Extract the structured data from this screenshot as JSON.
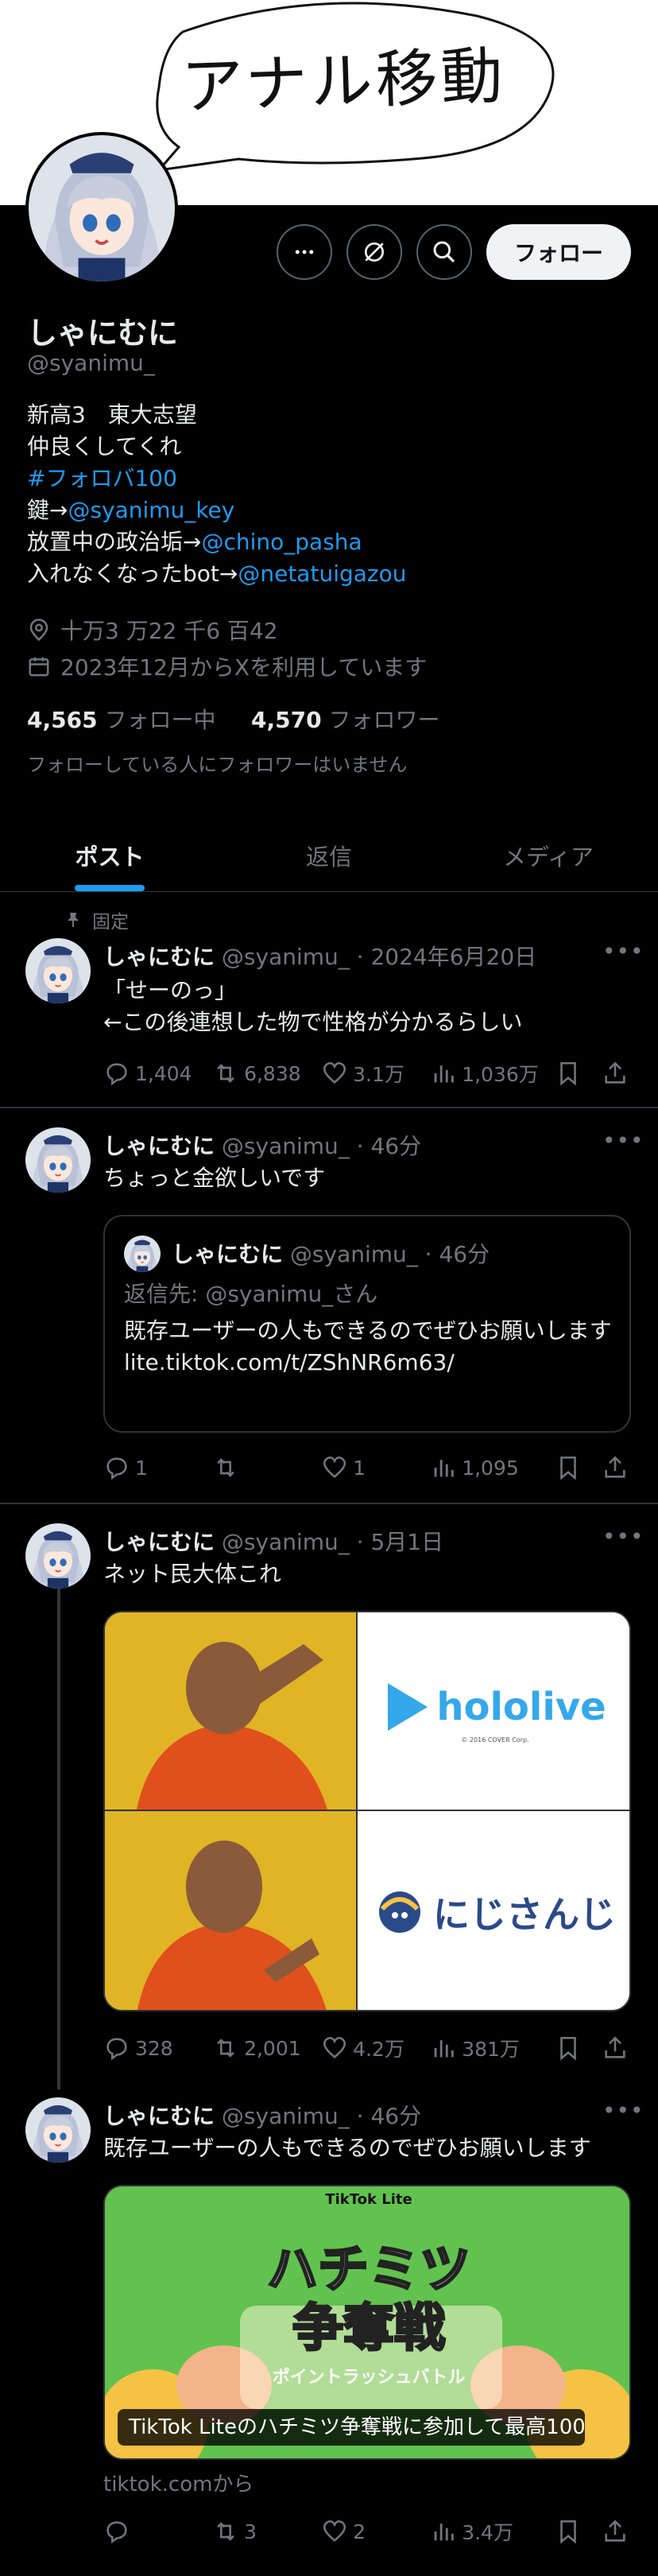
{
  "banner": {
    "text": "アナル移動"
  },
  "profile": {
    "name": "しゃにむに",
    "handle": "@syanimu_",
    "follow_label": "フォロー",
    "bio_line1": "新高3　東大志望",
    "bio_line2": "仲良くしてくれ",
    "bio_hashtag": "#フォロバ100",
    "bio_key_prefix": "鍵→",
    "bio_key_link": "@syanimu_key",
    "bio_pol_prefix": "放置中の政治垢→",
    "bio_pol_link": "@chino_pasha",
    "bio_bot_prefix": "入れなくなったbot→",
    "bio_bot_link": "@netatuigazou",
    "location": "十万3 万22 千6 百42",
    "joined": "2023年12月からXを利用しています",
    "following_count": "4,565",
    "following_label": "フォロー中",
    "followers_count": "4,570",
    "followers_label": "フォロワー",
    "mutual_note": "フォローしている人にフォロワーはいません"
  },
  "tabs": [
    {
      "label": "ポスト",
      "active": true
    },
    {
      "label": "返信",
      "active": false
    },
    {
      "label": "メディア",
      "active": false
    }
  ],
  "tweets": [
    {
      "pinned_label": "固定",
      "name": "しゃにむに",
      "handle_time": "@syanimu_ · 2024年6月20日",
      "text_line1": "「せーのっ」",
      "text_line2": "←この後連想した物で性格が分かるらしい",
      "replies": "1,404",
      "retweets": "6,838",
      "likes": "3.1万",
      "views": "1,036万"
    },
    {
      "name": "しゃにむに",
      "handle_time": "@syanimu_ · 46分",
      "text_line1": "ちょっと金欲しいです",
      "quote": {
        "name": "しゃにむに",
        "handle_time": "@syanimu_ · 46分",
        "reply_to": "返信先: @syanimu_さん",
        "text": "既存ユーザーの人もできるのでぜひお願いします",
        "link": "lite.tiktok.com/t/ZShNR6m63/"
      },
      "replies": "1",
      "retweets": "",
      "likes": "1",
      "views": "1,095"
    },
    {
      "name": "しゃにむに",
      "handle_time": "@syanimu_ · 5月1日",
      "text_line1": "ネット民大体これ",
      "image": {
        "top_label": "hololive",
        "top_sub": "© 2016 COVER Corp.",
        "bottom_label": "にじさんじ"
      },
      "replies": "328",
      "retweets": "2,001",
      "likes": "4.2万",
      "views": "381万"
    },
    {
      "name": "しゃにむに",
      "handle_time": "@syanimu_ · 46分",
      "text_line1": "既存ユーザーの人もできるのでぜひお願いします",
      "card": {
        "brand": "TikTok Lite",
        "title1": "ハチミツ",
        "title2": "争奪戦",
        "subtitle": "ポイントラッシュバトル",
        "caption": "TikTok Liteのハチミツ争奪戦に参加して最高100...",
        "source": "tiktok.comから"
      },
      "replies": "",
      "retweets": "3",
      "likes": "2",
      "views": "3.4万"
    }
  ],
  "colors": {
    "accent": "#1d9bf0",
    "muted": "#71767b",
    "border": "#2f3336"
  }
}
